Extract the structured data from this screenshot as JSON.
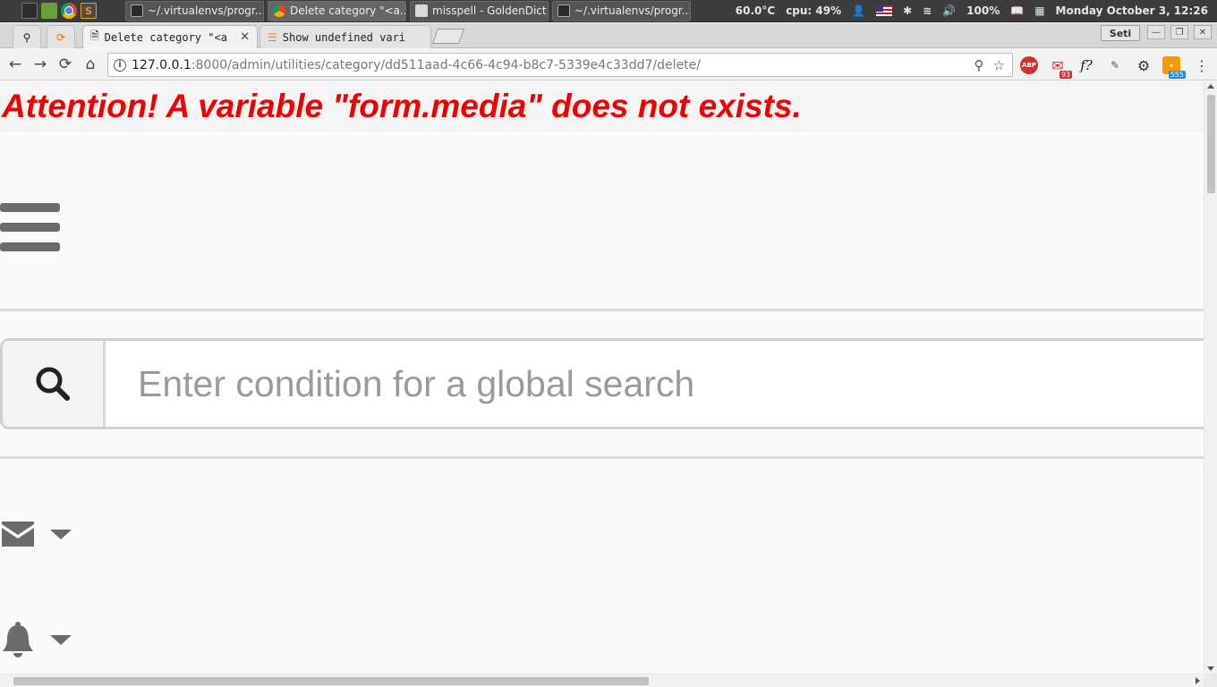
{
  "taskbar": {
    "launchers": [
      "terminal-icon",
      "files-icon",
      "chrome-icon",
      "sublime-icon"
    ],
    "windows": [
      {
        "title": "~/.virtualenvs/progr...",
        "icon": "terminal-icon"
      },
      {
        "title": "Delete category \"<a...",
        "icon": "chrome-icon"
      },
      {
        "title": "misspell - GoldenDict",
        "icon": "dictionary-icon"
      },
      {
        "title": "~/.virtualenvs/progr...",
        "icon": "terminal-icon"
      }
    ],
    "status": {
      "temperature": "60.0°C",
      "cpu": "cpu: 49%",
      "battery": "100%",
      "datetime": "Monday October  3, 12:26"
    }
  },
  "browser": {
    "tabs": [
      {
        "title": "Delete category \"<a",
        "active": true
      },
      {
        "title": "Show undefined vari",
        "active": false
      }
    ],
    "profile_label": "Seti",
    "url_host": "127.0.0.1",
    "url_rest": ":8000/admin/utilities/category/dd511aad-4c66-4c94-b8c7-5339e4c33dd7/delete/",
    "extension_badges": {
      "mail": "93",
      "rss": "555"
    },
    "extension_abp_label": "ABP",
    "extension_fx_label": "f?"
  },
  "page": {
    "attention": "Attention! A variable \"form.media\" does not exists.",
    "search_placeholder": "Enter condition for a global search"
  },
  "colors": {
    "attention_text": "#ee0000",
    "icon_gray": "#6b6b6b"
  }
}
